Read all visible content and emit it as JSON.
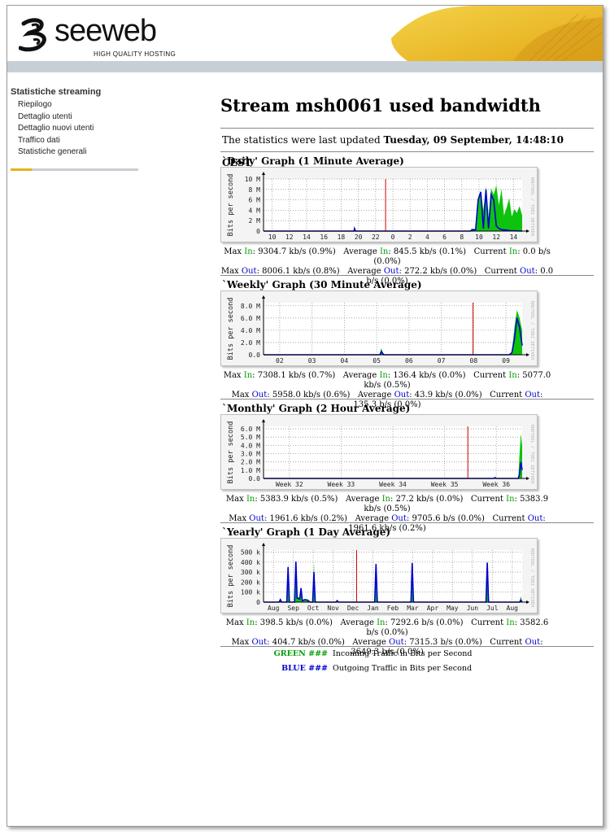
{
  "header": {
    "brand": "seeweb",
    "tagline": "HIGH QUALITY HOSTING"
  },
  "sidebar": {
    "title": "Statistiche streaming",
    "items": [
      {
        "label": "Riepilogo"
      },
      {
        "label": "Dettaglio utenti"
      },
      {
        "label": "Dettaglio nuovi utenti"
      },
      {
        "label": "Traffico dati"
      },
      {
        "label": "Statistiche generali"
      }
    ]
  },
  "main": {
    "title": "Stream msh0061 used bandwidth",
    "updated_prefix": "The statistics were last updated",
    "updated_value": "Tuesday, 09 September, 14:48:10 CEST",
    "legend": [
      {
        "key": "GREEN ###",
        "text": "Incoming Traffic in Bits per Second"
      },
      {
        "key": "BLUE ###",
        "text": "Outgoing Traffic in Bits per Second"
      }
    ]
  },
  "colors": {
    "in": "#00c000",
    "out": "#0000d0",
    "now_marker": "#cc0000",
    "accent": "#e8b21a"
  },
  "chart_data": [
    {
      "type": "area",
      "title": "`Daily' Graph (1 Minute Average)",
      "ylabel": "Bits per second",
      "side_label": "RRDTOOL / TOBI OETIKER",
      "x_ticks": [
        "10",
        "12",
        "14",
        "16",
        "18",
        "20",
        "22",
        "0",
        "2",
        "4",
        "6",
        "8",
        "10",
        "12",
        "14"
      ],
      "y_ticks": [
        "0",
        "2 M",
        "4 M",
        "6 M",
        "8 M",
        "10 M"
      ],
      "ylim": [
        0,
        10
      ],
      "marker_x": 0.472,
      "series": [
        {
          "name": "In",
          "points": [
            [
              0,
              0
            ],
            [
              0.35,
              0
            ],
            [
              0.352,
              0.6
            ],
            [
              0.356,
              0
            ],
            [
              0.8,
              0
            ],
            [
              0.805,
              0.5
            ],
            [
              0.82,
              0.3
            ],
            [
              0.83,
              6.5
            ],
            [
              0.84,
              7.8
            ],
            [
              0.85,
              4.0
            ],
            [
              0.86,
              8.6
            ],
            [
              0.87,
              2.5
            ],
            [
              0.88,
              8.2
            ],
            [
              0.89,
              7.0
            ],
            [
              0.9,
              8.8
            ],
            [
              0.91,
              5.0
            ],
            [
              0.92,
              8.1
            ],
            [
              0.93,
              3.0
            ],
            [
              0.94,
              4.5
            ],
            [
              0.95,
              6.3
            ],
            [
              0.96,
              2.8
            ],
            [
              0.97,
              4.2
            ],
            [
              0.98,
              3.5
            ],
            [
              0.99,
              4.8
            ],
            [
              1.0,
              3.0
            ]
          ]
        },
        {
          "name": "Out",
          "points": [
            [
              0,
              0
            ],
            [
              0.35,
              0
            ],
            [
              0.352,
              0.5
            ],
            [
              0.356,
              0
            ],
            [
              0.8,
              0
            ],
            [
              0.805,
              0.2
            ],
            [
              0.82,
              0.3
            ],
            [
              0.83,
              6.0
            ],
            [
              0.84,
              7.5
            ],
            [
              0.85,
              0.5
            ],
            [
              0.86,
              8.0
            ],
            [
              0.87,
              0.5
            ],
            [
              0.88,
              7.0
            ],
            [
              0.89,
              6.0
            ],
            [
              0.9,
              1.0
            ],
            [
              0.91,
              0.5
            ],
            [
              0.92,
              0.3
            ],
            [
              0.93,
              0.2
            ],
            [
              0.94,
              0.2
            ],
            [
              0.95,
              0.1
            ],
            [
              1.0,
              0
            ]
          ]
        }
      ],
      "stats": [
        {
          "label": "Max",
          "in": "9304.7 kb/s (0.9%)",
          "out": "8006.1 kb/s (0.8%)"
        },
        {
          "label": "Average",
          "in": "845.5 kb/s (0.1%)",
          "out": "272.2 kb/s (0.0%)"
        },
        {
          "label": "Current",
          "in": "0.0 b/s (0.0%)",
          "out": "0.0 b/s (0.0%)"
        }
      ]
    },
    {
      "type": "area",
      "title": "`Weekly' Graph (30 Minute Average)",
      "ylabel": "Bits per second",
      "side_label": "RRDTOOL / TOBI OETIKER",
      "x_ticks": [
        "02",
        "03",
        "04",
        "05",
        "06",
        "07",
        "08",
        "09"
      ],
      "y_ticks": [
        "0.0",
        "2.0 M",
        "4.0 M",
        "6.0 M",
        "8.0 M"
      ],
      "ylim": [
        0,
        8.5
      ],
      "marker_x": 0.81,
      "series": [
        {
          "name": "In",
          "points": [
            [
              0,
              0
            ],
            [
              0.45,
              0
            ],
            [
              0.455,
              1.1
            ],
            [
              0.465,
              0
            ],
            [
              0.95,
              0
            ],
            [
              0.96,
              0.5
            ],
            [
              0.97,
              4.5
            ],
            [
              0.98,
              7.3
            ],
            [
              0.99,
              6.0
            ],
            [
              1.0,
              4.0
            ]
          ]
        },
        {
          "name": "Out",
          "points": [
            [
              0,
              0
            ],
            [
              0.45,
              0
            ],
            [
              0.455,
              0.5
            ],
            [
              0.465,
              0
            ],
            [
              0.95,
              0
            ],
            [
              0.96,
              0.3
            ],
            [
              0.97,
              2.5
            ],
            [
              0.98,
              6.0
            ],
            [
              0.99,
              4.5
            ],
            [
              1.0,
              1.5
            ]
          ]
        }
      ],
      "stats": [
        {
          "label": "Max",
          "in": "7308.1 kb/s (0.7%)",
          "out": "5958.0 kb/s (0.6%)"
        },
        {
          "label": "Average",
          "in": "136.4 kb/s (0.0%)",
          "out": "43.9 kb/s (0.0%)"
        },
        {
          "label": "Current",
          "in": "5077.0 kb/s (0.5%)",
          "out": "135.3 b/s (0.0%)"
        }
      ]
    },
    {
      "type": "area",
      "title": "`Monthly' Graph (2 Hour Average)",
      "ylabel": "Bits per second",
      "side_label": "RRDTOOL / TOBI OETIKER",
      "x_ticks": [
        "Week 32",
        "Week 33",
        "Week 34",
        "Week 35",
        "Week 36"
      ],
      "y_ticks": [
        "0.0",
        "1.0 M",
        "2.0 M",
        "3.0 M",
        "4.0 M",
        "5.0 M",
        "6.0 M"
      ],
      "ylim": [
        0,
        6.3
      ],
      "marker_x": 0.79,
      "series": [
        {
          "name": "In",
          "points": [
            [
              0,
              0
            ],
            [
              0.89,
              0
            ],
            [
              0.895,
              0.2
            ],
            [
              0.9,
              0
            ],
            [
              0.985,
              0
            ],
            [
              0.99,
              3.0
            ],
            [
              0.995,
              5.4
            ],
            [
              1.0,
              4.0
            ]
          ]
        },
        {
          "name": "Out",
          "points": [
            [
              0,
              0
            ],
            [
              0.89,
              0
            ],
            [
              0.895,
              0.1
            ],
            [
              0.9,
              0
            ],
            [
              0.985,
              0
            ],
            [
              0.99,
              0.5
            ],
            [
              0.995,
              2.0
            ],
            [
              1.0,
              1.0
            ]
          ]
        }
      ],
      "stats": [
        {
          "label": "Max",
          "in": "5383.9 kb/s (0.5%)",
          "out": "1961.6 kb/s (0.2%)"
        },
        {
          "label": "Average",
          "in": "27.2 kb/s (0.0%)",
          "out": "9705.6 b/s (0.0%)"
        },
        {
          "label": "Current",
          "in": "5383.9 kb/s (0.5%)",
          "out": "1961.6 kb/s (0.2%)"
        }
      ]
    },
    {
      "type": "area",
      "title": "`Yearly' Graph (1 Day Average)",
      "ylabel": "Bits per second",
      "side_label": "RRDTOOL / TOBI OETIKER",
      "x_ticks": [
        "Aug",
        "Sep",
        "Oct",
        "Nov",
        "Dec",
        "Jan",
        "Feb",
        "Mar",
        "Apr",
        "May",
        "Jun",
        "Jul",
        "Aug"
      ],
      "y_ticks": [
        "0",
        "100 k",
        "200 k",
        "300 k",
        "400 k",
        "500 k"
      ],
      "ylim": [
        0,
        520
      ],
      "marker_x": 0.36,
      "series": [
        {
          "name": "In",
          "points": [
            [
              0,
              0
            ],
            [
              0.06,
              0
            ],
            [
              0.065,
              30
            ],
            [
              0.07,
              0
            ],
            [
              0.09,
              0
            ],
            [
              0.095,
              390
            ],
            [
              0.1,
              0
            ],
            [
              0.12,
              0
            ],
            [
              0.125,
              400
            ],
            [
              0.13,
              60
            ],
            [
              0.14,
              40
            ],
            [
              0.145,
              150
            ],
            [
              0.15,
              20
            ],
            [
              0.16,
              30
            ],
            [
              0.17,
              25
            ],
            [
              0.18,
              0
            ],
            [
              0.19,
              0
            ],
            [
              0.195,
              395
            ],
            [
              0.2,
              0
            ],
            [
              0.28,
              0
            ],
            [
              0.285,
              20
            ],
            [
              0.29,
              0
            ],
            [
              0.43,
              0
            ],
            [
              0.435,
              390
            ],
            [
              0.44,
              0
            ],
            [
              0.57,
              0
            ],
            [
              0.575,
              395
            ],
            [
              0.58,
              0
            ],
            [
              0.86,
              0
            ],
            [
              0.865,
              400
            ],
            [
              0.87,
              0
            ],
            [
              0.99,
              0
            ],
            [
              0.995,
              60
            ],
            [
              1.0,
              0
            ]
          ]
        },
        {
          "name": "Out",
          "points": [
            [
              0,
              0
            ],
            [
              0.06,
              0
            ],
            [
              0.065,
              25
            ],
            [
              0.07,
              0
            ],
            [
              0.09,
              0
            ],
            [
              0.095,
              350
            ],
            [
              0.1,
              0
            ],
            [
              0.12,
              0
            ],
            [
              0.125,
              405
            ],
            [
              0.13,
              40
            ],
            [
              0.14,
              30
            ],
            [
              0.145,
              140
            ],
            [
              0.15,
              15
            ],
            [
              0.16,
              25
            ],
            [
              0.17,
              20
            ],
            [
              0.18,
              0
            ],
            [
              0.19,
              0
            ],
            [
              0.195,
              300
            ],
            [
              0.2,
              0
            ],
            [
              0.28,
              0
            ],
            [
              0.285,
              15
            ],
            [
              0.29,
              0
            ],
            [
              0.43,
              0
            ],
            [
              0.435,
              380
            ],
            [
              0.44,
              0
            ],
            [
              0.57,
              0
            ],
            [
              0.575,
              390
            ],
            [
              0.58,
              0
            ],
            [
              0.86,
              0
            ],
            [
              0.865,
              395
            ],
            [
              0.87,
              0
            ],
            [
              0.99,
              0
            ],
            [
              0.995,
              20
            ],
            [
              1.0,
              0
            ]
          ]
        }
      ],
      "stats": [
        {
          "label": "Max",
          "in": "398.5 kb/s (0.0%)",
          "out": "404.7 kb/s (0.0%)"
        },
        {
          "label": "Average",
          "in": "7292.6 b/s (0.0%)",
          "out": "7315.3 b/s (0.0%)"
        },
        {
          "label": "Current",
          "in": "3582.6 b/s (0.0%)",
          "out": "3649.3 b/s (0.0%)"
        }
      ]
    }
  ]
}
